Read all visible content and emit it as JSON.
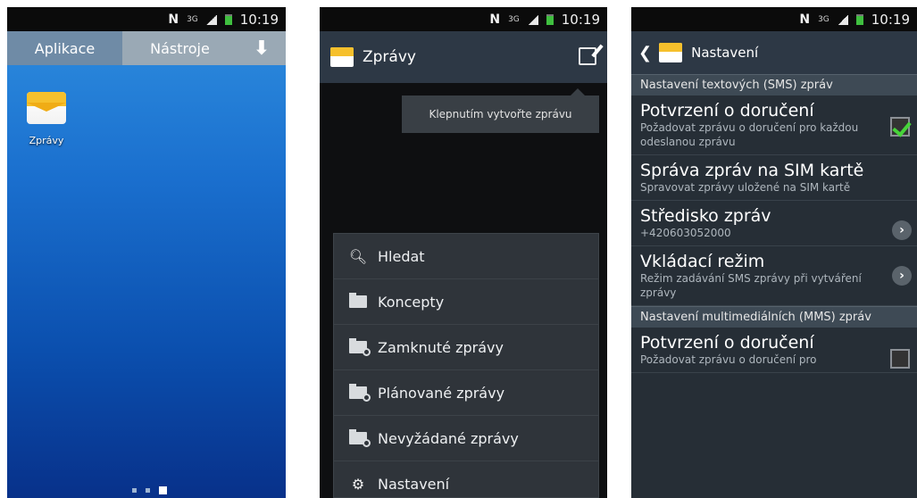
{
  "statusbar": {
    "network": "N",
    "data": "3G",
    "time": "10:19"
  },
  "home": {
    "tabs": [
      {
        "label": "Aplikace"
      },
      {
        "label": "Nástroje"
      }
    ],
    "download_icon": "download-icon",
    "app_label": "Zprávy",
    "page_indicator_count": 3,
    "page_indicator_active": 3
  },
  "messages": {
    "title": "Zprávy",
    "tooltip": "Klepnutím vytvořte zprávu",
    "menu": [
      {
        "label": "Hledat",
        "icon": "search-icon"
      },
      {
        "label": "Koncepty",
        "icon": "drafts-icon"
      },
      {
        "label": "Zamknuté zprávy",
        "icon": "locked-folder-icon"
      },
      {
        "label": "Plánované zprávy",
        "icon": "scheduled-folder-icon"
      },
      {
        "label": "Nevyžádané zprávy",
        "icon": "spam-folder-icon"
      },
      {
        "label": "Nastavení",
        "icon": "gear-icon"
      }
    ]
  },
  "settings": {
    "title": "Nastavení",
    "section_sms": "Nastavení textových (SMS) zpráv",
    "items": [
      {
        "title": "Potvrzení o doručení",
        "subtitle": "Požadovat zprávu o doručení pro každou odeslanou zprávu",
        "control": "checkbox",
        "checked": true
      },
      {
        "title": "Správa zpráv na SIM kartě",
        "subtitle": "Spravovat zprávy uložené na SIM kartě",
        "control": "none"
      },
      {
        "title": "Středisko zpráv",
        "subtitle": "+420603052000",
        "control": "chevron"
      },
      {
        "title": "Vkládací režim",
        "subtitle": "Režim zadávání SMS zprávy při vytváření zprávy",
        "control": "chevron"
      }
    ],
    "section_mms": "Nastavení multimediálních (MMS) zpráv",
    "mms_item": {
      "title": "Potvrzení o doručení",
      "subtitle": "Požadovat zprávu o doručení pro",
      "control": "checkbox",
      "checked": false
    }
  },
  "colors": {
    "accent_green": "#47d43a",
    "actionbar": "#2d3845",
    "envelope_yellow": "#f6c02c"
  }
}
